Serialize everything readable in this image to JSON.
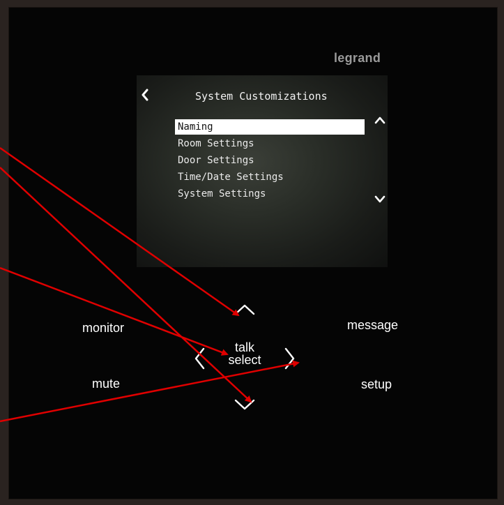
{
  "device": {
    "brand": "legrand"
  },
  "screen": {
    "title": "System Customizations",
    "back_icon": "chevron-left-icon",
    "menu": {
      "items": [
        {
          "label": "Naming",
          "selected": true
        },
        {
          "label": "Room Settings",
          "selected": false
        },
        {
          "label": "Door Settings",
          "selected": false
        },
        {
          "label": "Time/Date Settings",
          "selected": false
        },
        {
          "label": "System Settings",
          "selected": false
        }
      ]
    },
    "scroll_up_icon": "chevron-up-icon",
    "scroll_down_icon": "chevron-down-icon"
  },
  "buttons": {
    "monitor": "monitor",
    "message": "message",
    "mute": "mute",
    "setup": "setup",
    "talk": "talk",
    "select": "select"
  },
  "nav_icons": {
    "up": "chevron-up-icon",
    "down": "chevron-down-icon",
    "left": "chevron-left-icon",
    "right": "chevron-right-icon"
  },
  "colors": {
    "annotation_arrow": "#e00000",
    "device_face": "#050505",
    "selection_highlight": "#ffffff"
  }
}
